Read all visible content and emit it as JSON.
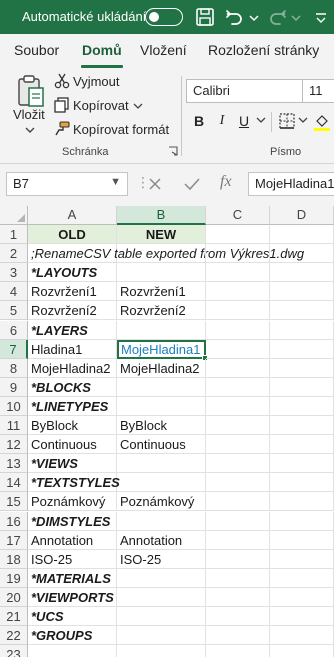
{
  "titlebar": {
    "autosave_label": "Automatické ukládání",
    "autosave_state": "Vyp",
    "icons": [
      "save-icon",
      "undo-icon",
      "redo-icon"
    ]
  },
  "tabs": [
    "Soubor",
    "Domů",
    "Vložení",
    "Rozložení stránky"
  ],
  "active_tab": "Domů",
  "ribbon": {
    "paste_label": "Vložit",
    "cut_label": "Vyjmout",
    "copy_label": "Kopírovat",
    "format_painter_label": "Kopírovat formát",
    "clipboard_group": "Schránka",
    "font_name": "Calibri",
    "font_size": "11",
    "bold": "B",
    "italic": "I",
    "underline": "U",
    "font_group": "Písmo"
  },
  "formula_bar": {
    "name_box": "B7",
    "fx": "fx",
    "content": "MojeHladina1"
  },
  "columns": [
    "A",
    "B",
    "C",
    "D"
  ],
  "selected_column": "B",
  "selected_row": "7",
  "active_cell": "B7",
  "rows": [
    {
      "num": "1",
      "a": "OLD",
      "b": "NEW",
      "style": "header"
    },
    {
      "num": "2",
      "a": ";RenameCSV table exported from Výkres1.dwg",
      "b": "",
      "style": "italic"
    },
    {
      "num": "3",
      "a": "*LAYOUTS",
      "b": "",
      "style": "bolditalic"
    },
    {
      "num": "4",
      "a": "Rozvržení1",
      "b": "Rozvržení1",
      "style": ""
    },
    {
      "num": "5",
      "a": "Rozvržení2",
      "b": "Rozvržení2",
      "style": ""
    },
    {
      "num": "6",
      "a": "*LAYERS",
      "b": "",
      "style": "bolditalic"
    },
    {
      "num": "7",
      "a": "Hladina1",
      "b": "MojeHladina1",
      "style": ""
    },
    {
      "num": "8",
      "a": "MojeHladina2",
      "b": "MojeHladina2",
      "style": ""
    },
    {
      "num": "9",
      "a": "*BLOCKS",
      "b": "",
      "style": "bolditalic"
    },
    {
      "num": "10",
      "a": "*LINETYPES",
      "b": "",
      "style": "bolditalic"
    },
    {
      "num": "11",
      "a": "ByBlock",
      "b": "ByBlock",
      "style": ""
    },
    {
      "num": "12",
      "a": "Continuous",
      "b": "Continuous",
      "style": ""
    },
    {
      "num": "13",
      "a": "*VIEWS",
      "b": "",
      "style": "bolditalic"
    },
    {
      "num": "14",
      "a": "*TEXTSTYLES",
      "b": "",
      "style": "bolditalic"
    },
    {
      "num": "15",
      "a": "Poznámkový",
      "b": "Poznámkový",
      "style": ""
    },
    {
      "num": "16",
      "a": "*DIMSTYLES",
      "b": "",
      "style": "bolditalic"
    },
    {
      "num": "17",
      "a": "Annotation",
      "b": "Annotation",
      "style": ""
    },
    {
      "num": "18",
      "a": "ISO-25",
      "b": "ISO-25",
      "style": ""
    },
    {
      "num": "19",
      "a": "*MATERIALS",
      "b": "",
      "style": "bolditalic"
    },
    {
      "num": "20",
      "a": "*VIEWPORTS",
      "b": "",
      "style": "bolditalic"
    },
    {
      "num": "21",
      "a": "*UCS",
      "b": "",
      "style": "bolditalic"
    },
    {
      "num": "22",
      "a": "*GROUPS",
      "b": "",
      "style": "bolditalic"
    },
    {
      "num": "23",
      "a": "",
      "b": "",
      "style": ""
    }
  ],
  "colors": {
    "accent": "#217346",
    "header_fill": "#e2efda",
    "active_text": "#1a7fbf"
  }
}
